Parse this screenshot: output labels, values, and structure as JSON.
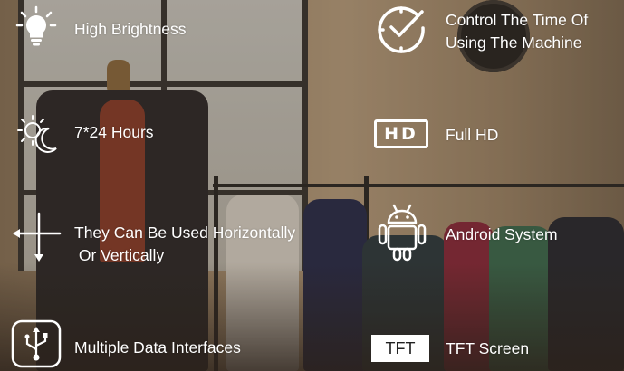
{
  "features": {
    "high_brightness": {
      "label": "High Brightness",
      "icon": "lightbulb-icon"
    },
    "hours": {
      "label": "7*24 Hours",
      "icon": "sun-moon-icon"
    },
    "orientation": {
      "label_line1": "They Can Be Used Horizontally",
      "label_line2": " Or Vertically",
      "icon": "arrows-cross-icon"
    },
    "data_interfaces": {
      "label": "Multiple Data Interfaces",
      "icon": "usb-icon"
    },
    "time_control": {
      "label_line1": "Control The Time Of",
      "label_line2": "Using The Machine",
      "icon": "clock-check-icon"
    },
    "full_hd": {
      "label": "Full HD",
      "icon": "hd-icon",
      "badge": "HD"
    },
    "android": {
      "label": "Android System",
      "icon": "android-icon"
    },
    "tft": {
      "label": "TFT Screen",
      "badge": "TFT"
    }
  }
}
